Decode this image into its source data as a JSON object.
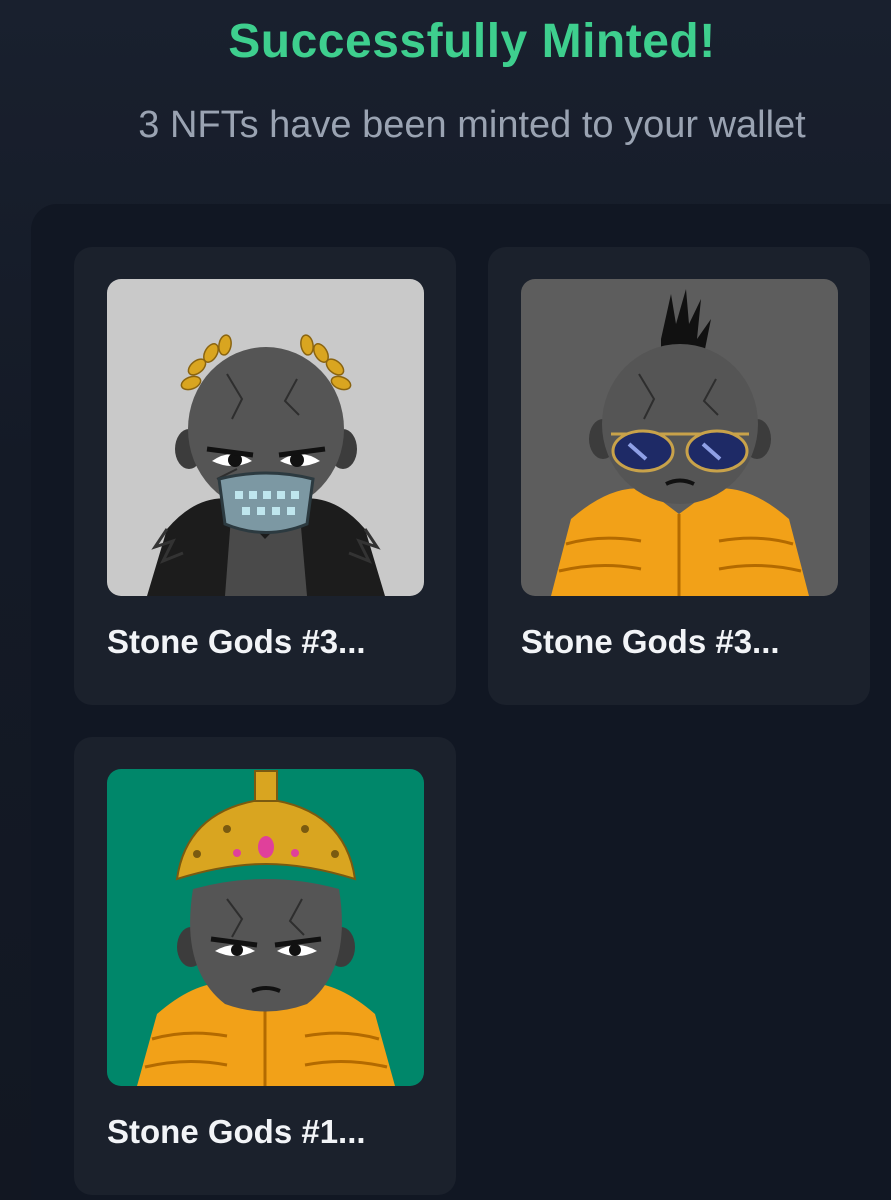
{
  "header": {
    "title": "Successfully Minted!",
    "subtitle": "3 NFTs have been minted to your wallet"
  },
  "nfts": [
    {
      "name": "Stone Gods #3...",
      "background": "#c9c9c9",
      "headwear": "gold-laurel",
      "outfit": "fur-coat",
      "accessory": "cyber-mask"
    },
    {
      "name": "Stone Gods #3...",
      "background": "#5d5d5d",
      "headwear": "mohawk",
      "outfit": "orange-puffer-jacket",
      "accessory": "aviator-sunglasses"
    },
    {
      "name": "Stone Gods #1...",
      "background": "#00876a",
      "headwear": "golden-crown",
      "outfit": "orange-puffer-jacket",
      "accessory": "none"
    }
  ],
  "colors": {
    "accent": "#3ecf8e",
    "subtitle": "#9aa3b2",
    "card": "#1b212c",
    "jacket": "#f2a118",
    "gold": "#d9a520"
  }
}
